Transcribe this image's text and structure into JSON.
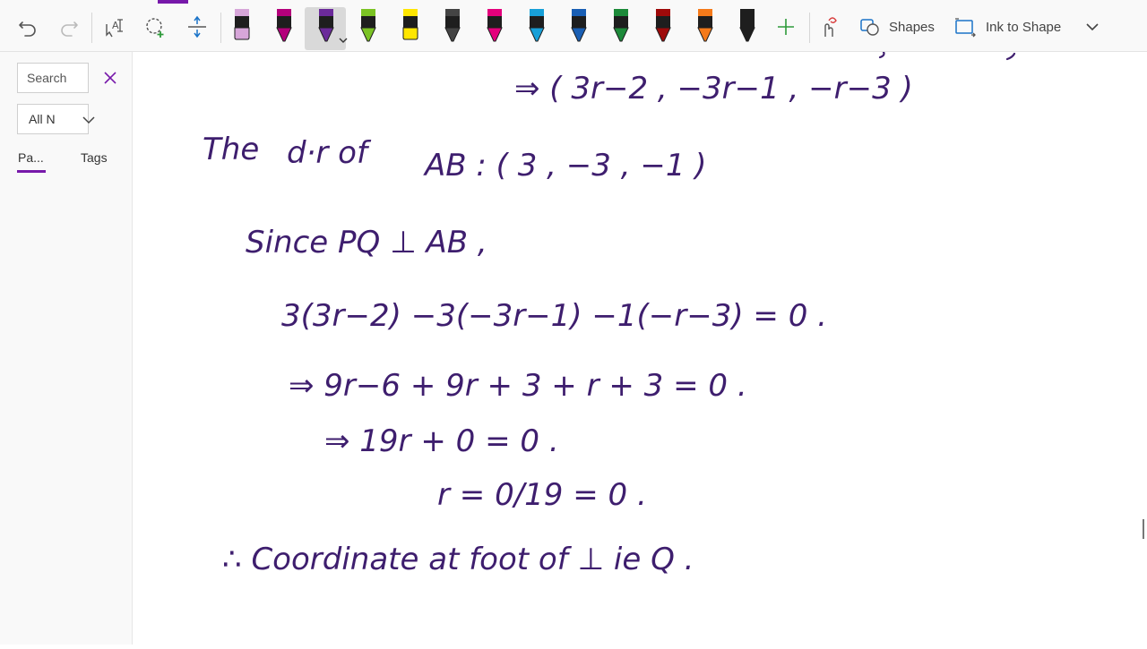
{
  "toolbar": {
    "shapes_label": "Shapes",
    "ink_to_shape_label": "Ink to Shape",
    "icons": [
      "undo-icon",
      "redo-icon",
      "type-select-icon",
      "lasso-select-icon",
      "add-space-icon",
      "highlighter-icon",
      "pen-icon",
      "add-pen-icon",
      "ink-replay-icon",
      "shapes-icon",
      "ink-to-shape-icon",
      "chevron-down-icon"
    ],
    "pens": [
      {
        "name": "pen-lilac-highlighter",
        "color": "#d7a6d9"
      },
      {
        "name": "pen-magenta",
        "color": "#b4007b"
      },
      {
        "name": "pen-purple-selected",
        "color": "#6b2a9a"
      },
      {
        "name": "pen-green",
        "color": "#7bc324"
      },
      {
        "name": "pen-yellow-highlighter",
        "color": "#ffe600"
      },
      {
        "name": "pen-galaxy",
        "color": "#444444"
      },
      {
        "name": "pen-pink",
        "color": "#e4007c"
      },
      {
        "name": "pen-light-blue",
        "color": "#18a0d8"
      },
      {
        "name": "pen-dark-blue",
        "color": "#1a5fb4"
      },
      {
        "name": "pen-dark-green",
        "color": "#1d8a3a"
      },
      {
        "name": "pen-dark-red",
        "color": "#9e0a0a"
      },
      {
        "name": "pen-orange",
        "color": "#f57a1a"
      },
      {
        "name": "pen-black",
        "color": "#1e1e1e"
      }
    ]
  },
  "left_pane": {
    "search_placeholder": "Search",
    "filter_value": "All N",
    "tabs": [
      "Pa...",
      "Tags"
    ]
  },
  "accent_color": "#7719aa",
  "ink_color": "#3e1e6e",
  "notes": {
    "line_1": "⇒ ( 3r−2 , −3r−1 , −r−3 )",
    "line_2_prefix": "The",
    "line_2_mid": "d·r of",
    "line_2_ab": "AB : ( 3 , −3 , −1 )",
    "line_3": "Since PQ ⊥ AB ,",
    "line_4": "3(3r−2) −3(−3r−1) −1(−r−3) = 0 .",
    "line_5": "⇒  9r−6 + 9r + 3 + r + 3 = 0 .",
    "line_6": "⇒  19r + 0 = 0 .",
    "line_7": "r = 0/19 = 0 .",
    "line_8": "∴ Coordinate at foot of ⊥ ie Q ."
  }
}
